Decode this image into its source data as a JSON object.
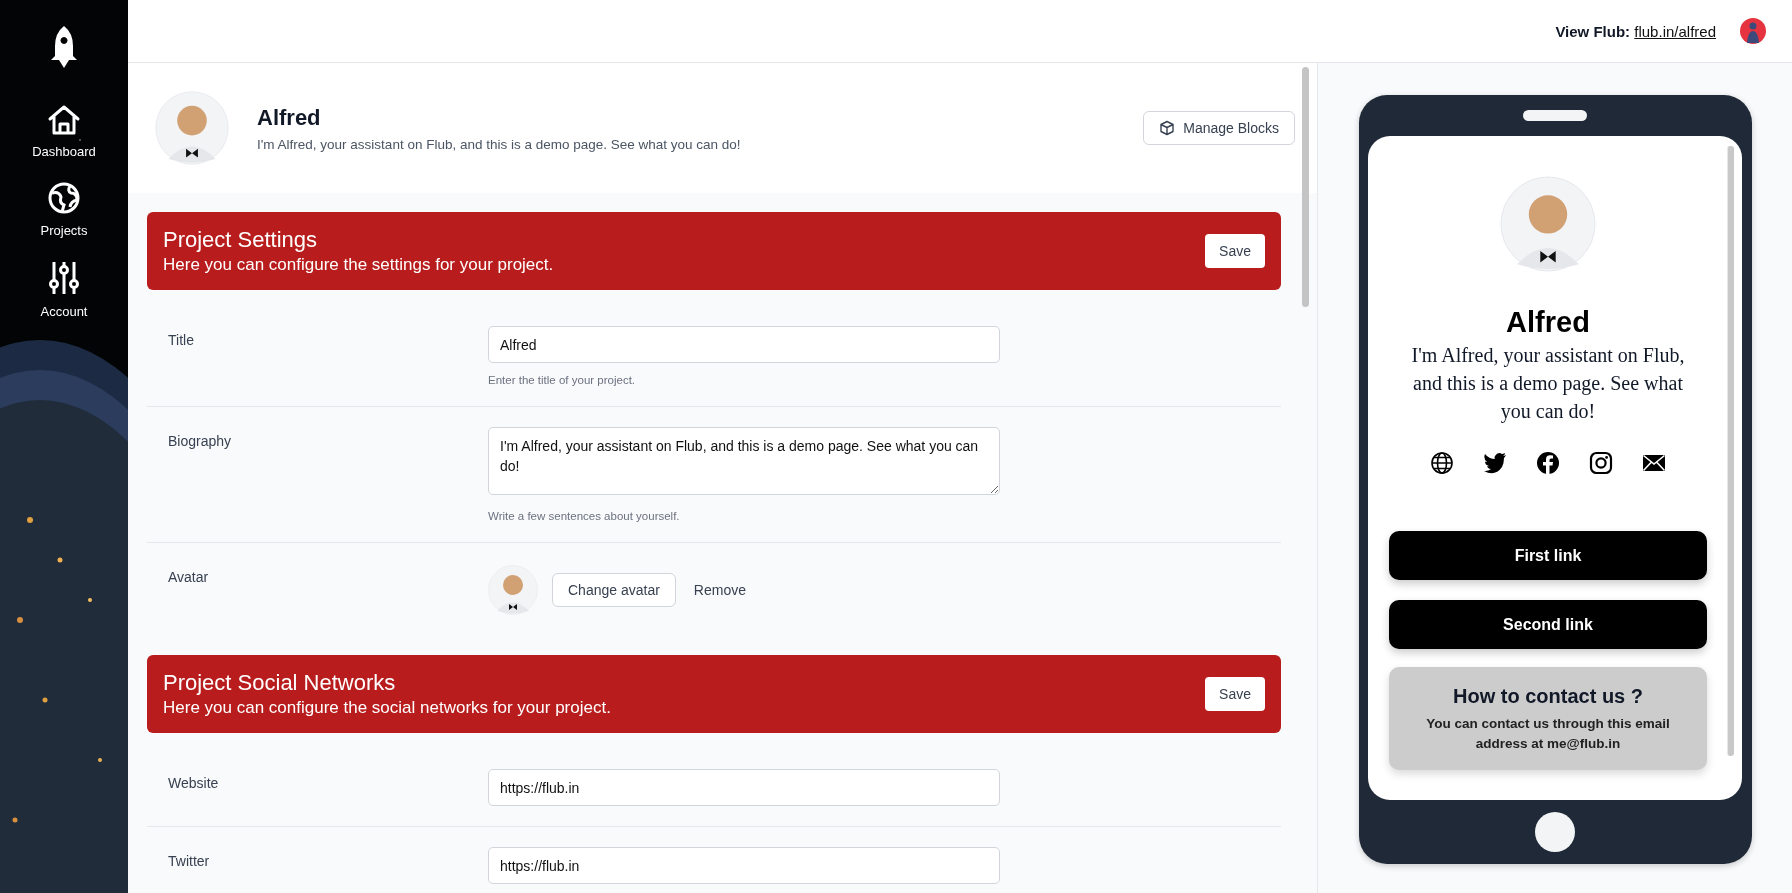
{
  "sidebar": {
    "items": [
      {
        "label": "Dashboard"
      },
      {
        "label": "Projects"
      },
      {
        "label": "Account"
      }
    ]
  },
  "topbar": {
    "view_label": "View Flub:",
    "view_link": "flub.in/alfred"
  },
  "profile": {
    "name": "Alfred",
    "bio": "I'm Alfred, your assistant on Flub, and this is a demo page. See what you can do!",
    "manage_button": "Manage Blocks"
  },
  "sections": [
    {
      "title": "Project Settings",
      "subtitle": "Here you can configure the settings for your project.",
      "save": "Save",
      "fields": [
        {
          "kind": "input",
          "label": "Title",
          "value": "Alfred",
          "help": "Enter the title of your project."
        },
        {
          "kind": "textarea",
          "label": "Biography",
          "value": "I'm Alfred, your assistant on Flub, and this is a demo page. See what you can do!",
          "help": "Write a few sentences about yourself."
        },
        {
          "kind": "avatar",
          "label": "Avatar",
          "change": "Change avatar",
          "remove": "Remove"
        }
      ]
    },
    {
      "title": "Project Social Networks",
      "subtitle": "Here you can configure the social networks for your project.",
      "save": "Save",
      "fields": [
        {
          "kind": "input",
          "label": "Website",
          "value": "https://flub.in"
        },
        {
          "kind": "input",
          "label": "Twitter",
          "value": "https://flub.in"
        }
      ]
    }
  ],
  "preview": {
    "name": "Alfred",
    "bio": "I'm Alfred, your assistant on Flub, and this is a demo page. See what you can do!",
    "links": [
      "First link",
      "Second link"
    ],
    "contact": {
      "title": "How to contact us ?",
      "text": "You can contact us through this email address at me@flub.in"
    }
  }
}
